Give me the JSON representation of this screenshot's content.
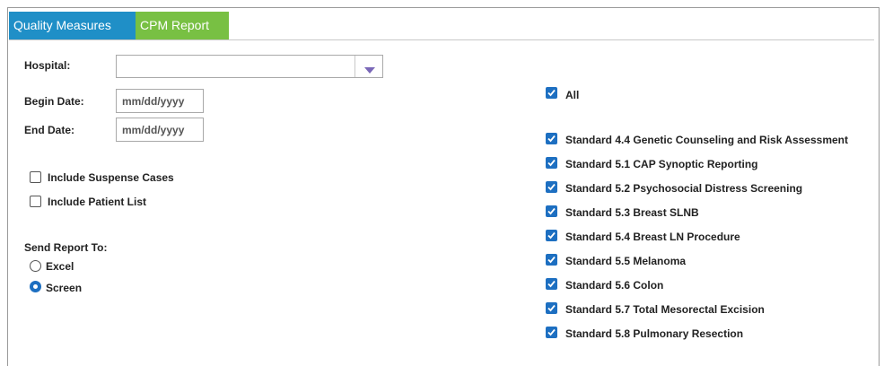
{
  "tabs": [
    {
      "label": "Quality Measures"
    },
    {
      "label": "CPM Report"
    }
  ],
  "form": {
    "hospital_label": "Hospital:",
    "hospital_value": "",
    "begin_date_label": "Begin Date:",
    "begin_date_placeholder": "mm/dd/yyyy",
    "end_date_label": "End Date:",
    "end_date_placeholder": "mm/dd/yyyy",
    "include_suspense": {
      "label": "Include Suspense Cases",
      "checked": false
    },
    "include_patient_list": {
      "label": "Include Patient List",
      "checked": false
    },
    "send_report_label": "Send Report To:",
    "send_options": [
      {
        "label": "Excel",
        "selected": false
      },
      {
        "label": "Screen",
        "selected": true
      }
    ]
  },
  "standards": {
    "all": {
      "label": "All",
      "checked": true
    },
    "items": [
      {
        "label": "Standard 4.4 Genetic Counseling and Risk Assessment",
        "checked": true
      },
      {
        "label": "Standard 5.1 CAP Synoptic Reporting",
        "checked": true
      },
      {
        "label": "Standard 5.2 Psychosocial Distress Screening",
        "checked": true
      },
      {
        "label": "Standard 5.3 Breast SLNB",
        "checked": true
      },
      {
        "label": "Standard 5.4 Breast LN Procedure",
        "checked": true
      },
      {
        "label": "Standard 5.5 Melanoma",
        "checked": true
      },
      {
        "label": "Standard 5.6 Colon",
        "checked": true
      },
      {
        "label": "Standard 5.7 Total Mesorectal Excision",
        "checked": true
      },
      {
        "label": "Standard 5.8 Pulmonary Resection",
        "checked": true
      }
    ]
  },
  "colors": {
    "tab_quality": "#1f8fc7",
    "tab_cpm": "#78c043",
    "checkbox_checked": "#1d6fc1"
  }
}
